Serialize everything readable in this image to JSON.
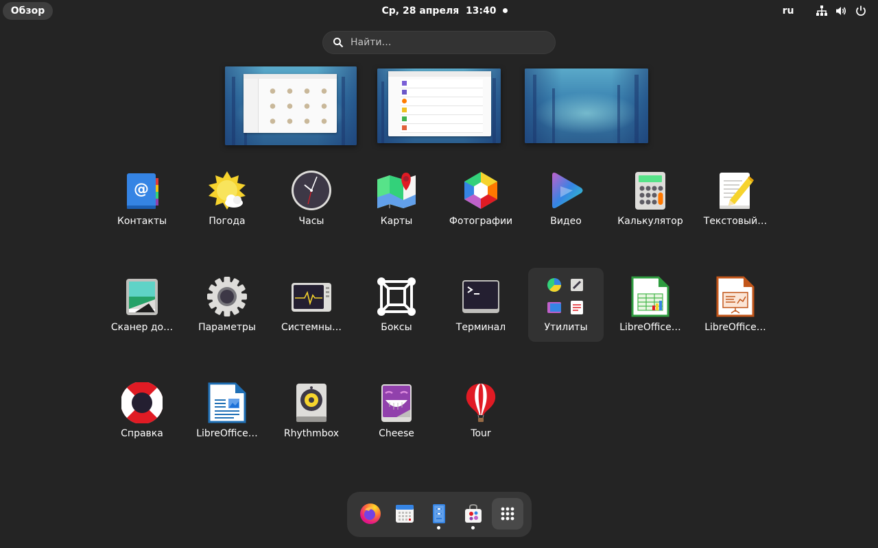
{
  "topbar": {
    "activities_label": "Обзор",
    "datetime": "Ср, 28 апреля  13:40",
    "keyboard_layout": "ru",
    "tray_icons": [
      "network-icon",
      "volume-icon",
      "power-icon"
    ]
  },
  "search": {
    "placeholder": "Найти…"
  },
  "workspaces": [
    {
      "name": "workspace-1",
      "content": "file-manager-window"
    },
    {
      "name": "workspace-2",
      "content": "software-list-window"
    },
    {
      "name": "workspace-3",
      "content": "empty"
    }
  ],
  "apps": [
    {
      "id": "contacts",
      "label": "Контакты",
      "icon": "contacts-icon"
    },
    {
      "id": "weather",
      "label": "Погода",
      "icon": "weather-icon"
    },
    {
      "id": "clocks",
      "label": "Часы",
      "icon": "clock-icon"
    },
    {
      "id": "maps",
      "label": "Карты",
      "icon": "maps-icon"
    },
    {
      "id": "photos",
      "label": "Фотографии",
      "icon": "photos-icon"
    },
    {
      "id": "video",
      "label": "Видео",
      "icon": "video-icon"
    },
    {
      "id": "calculator",
      "label": "Калькулятор",
      "icon": "calculator-icon"
    },
    {
      "id": "text-editor",
      "label": "Текстовый…",
      "icon": "text-editor-icon"
    },
    {
      "id": "scanner",
      "label": "Сканер до…",
      "icon": "scanner-icon"
    },
    {
      "id": "settings",
      "label": "Параметры",
      "icon": "gear-icon"
    },
    {
      "id": "system-monitor",
      "label": "Системны…",
      "icon": "system-monitor-icon"
    },
    {
      "id": "boxes",
      "label": "Боксы",
      "icon": "boxes-icon"
    },
    {
      "id": "terminal",
      "label": "Терминал",
      "icon": "terminal-icon"
    },
    {
      "id": "utilities",
      "label": "Утилиты",
      "icon": "folder-utilities-icon"
    },
    {
      "id": "libreoffice-calc",
      "label": "LibreOffice…",
      "icon": "libreoffice-calc-icon"
    },
    {
      "id": "libreoffice-impress",
      "label": "LibreOffice…",
      "icon": "libreoffice-impress-icon"
    },
    {
      "id": "help",
      "label": "Справка",
      "icon": "lifebuoy-icon"
    },
    {
      "id": "libreoffice-writer",
      "label": "LibreOffice…",
      "icon": "libreoffice-writer-icon"
    },
    {
      "id": "rhythmbox",
      "label": "Rhythmbox",
      "icon": "speaker-icon"
    },
    {
      "id": "cheese",
      "label": "Cheese",
      "icon": "cheese-icon"
    },
    {
      "id": "tour",
      "label": "Tour",
      "icon": "hot-air-balloon-icon"
    }
  ],
  "dock": [
    {
      "id": "firefox",
      "icon": "firefox-icon",
      "running": false
    },
    {
      "id": "calendar",
      "icon": "calendar-icon",
      "running": false
    },
    {
      "id": "files",
      "icon": "files-icon",
      "running": true
    },
    {
      "id": "software",
      "icon": "software-icon",
      "running": true
    },
    {
      "id": "show-apps",
      "icon": "app-grid-icon",
      "running": false
    }
  ],
  "colors": {
    "background": "#242424",
    "topbar_pill": "#3e3e3e",
    "dock": "#363636",
    "selected_tile": "#323232"
  }
}
